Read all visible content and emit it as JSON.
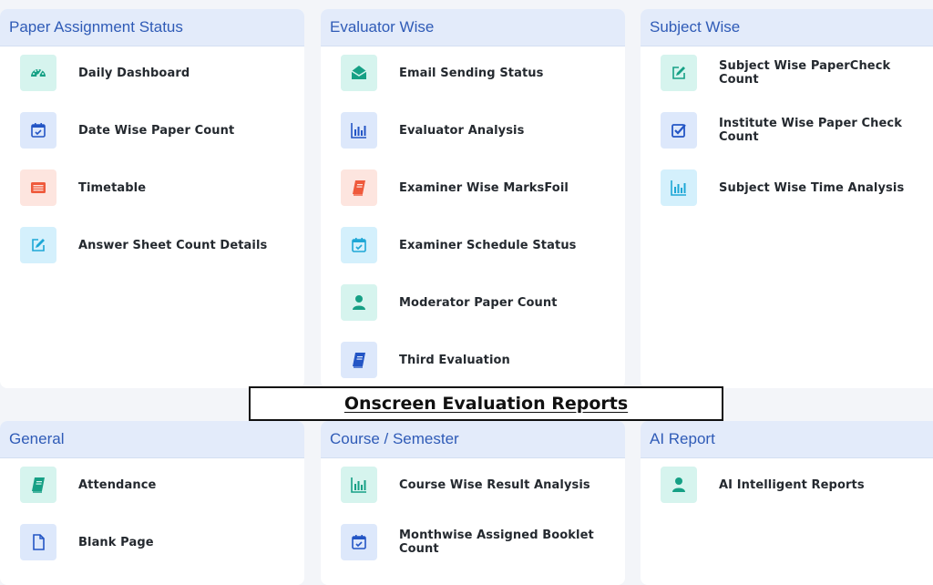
{
  "banner": {
    "title": "Onscreen Evaluation Reports"
  },
  "panels": {
    "paper_assignment": {
      "title": "Paper Assignment Status",
      "items": [
        {
          "label": "Daily Dashboard",
          "icon": "speedometer-icon",
          "tone": "teal"
        },
        {
          "label": "Date Wise Paper Count",
          "icon": "calendar-check-icon",
          "tone": "blue"
        },
        {
          "label": "Timetable",
          "icon": "list-card-icon",
          "tone": "red"
        },
        {
          "label": "Answer Sheet Count Details",
          "icon": "edit-icon",
          "tone": "cyan"
        }
      ]
    },
    "evaluator_wise": {
      "title": "Evaluator Wise",
      "items": [
        {
          "label": "Email Sending Status",
          "icon": "envelope-open-icon",
          "tone": "teal"
        },
        {
          "label": "Evaluator Analysis",
          "icon": "bar-chart-icon",
          "tone": "blue"
        },
        {
          "label": "Examiner Wise MarksFoil",
          "icon": "book-icon",
          "tone": "red"
        },
        {
          "label": "Examiner Schedule Status",
          "icon": "calendar-check-icon",
          "tone": "cyan"
        },
        {
          "label": "Moderator Paper Count",
          "icon": "user-icon",
          "tone": "teal"
        },
        {
          "label": "Third Evaluation",
          "icon": "book-icon",
          "tone": "blue"
        }
      ]
    },
    "subject_wise": {
      "title": "Subject Wise",
      "items": [
        {
          "label": "Subject Wise PaperCheck Count",
          "icon": "edit-icon",
          "tone": "teal"
        },
        {
          "label": "Institute Wise Paper Check Count",
          "icon": "checkbox-icon",
          "tone": "blue"
        },
        {
          "label": "Subject Wise Time Analysis",
          "icon": "bar-chart-icon",
          "tone": "cyan"
        }
      ]
    },
    "general": {
      "title": "General",
      "items": [
        {
          "label": "Attendance",
          "icon": "book-icon",
          "tone": "teal"
        },
        {
          "label": "Blank Page",
          "icon": "file-icon",
          "tone": "blue"
        }
      ]
    },
    "course_semester": {
      "title": "Course / Semester",
      "items": [
        {
          "label": "Course Wise Result Analysis",
          "icon": "bar-chart-icon",
          "tone": "teal"
        },
        {
          "label": "Monthwise Assigned Booklet Count",
          "icon": "calendar-check-icon",
          "tone": "blue"
        }
      ]
    },
    "ai_report": {
      "title": "AI Report",
      "items": [
        {
          "label": "AI Intelligent Reports",
          "icon": "user-icon",
          "tone": "teal"
        }
      ]
    }
  }
}
